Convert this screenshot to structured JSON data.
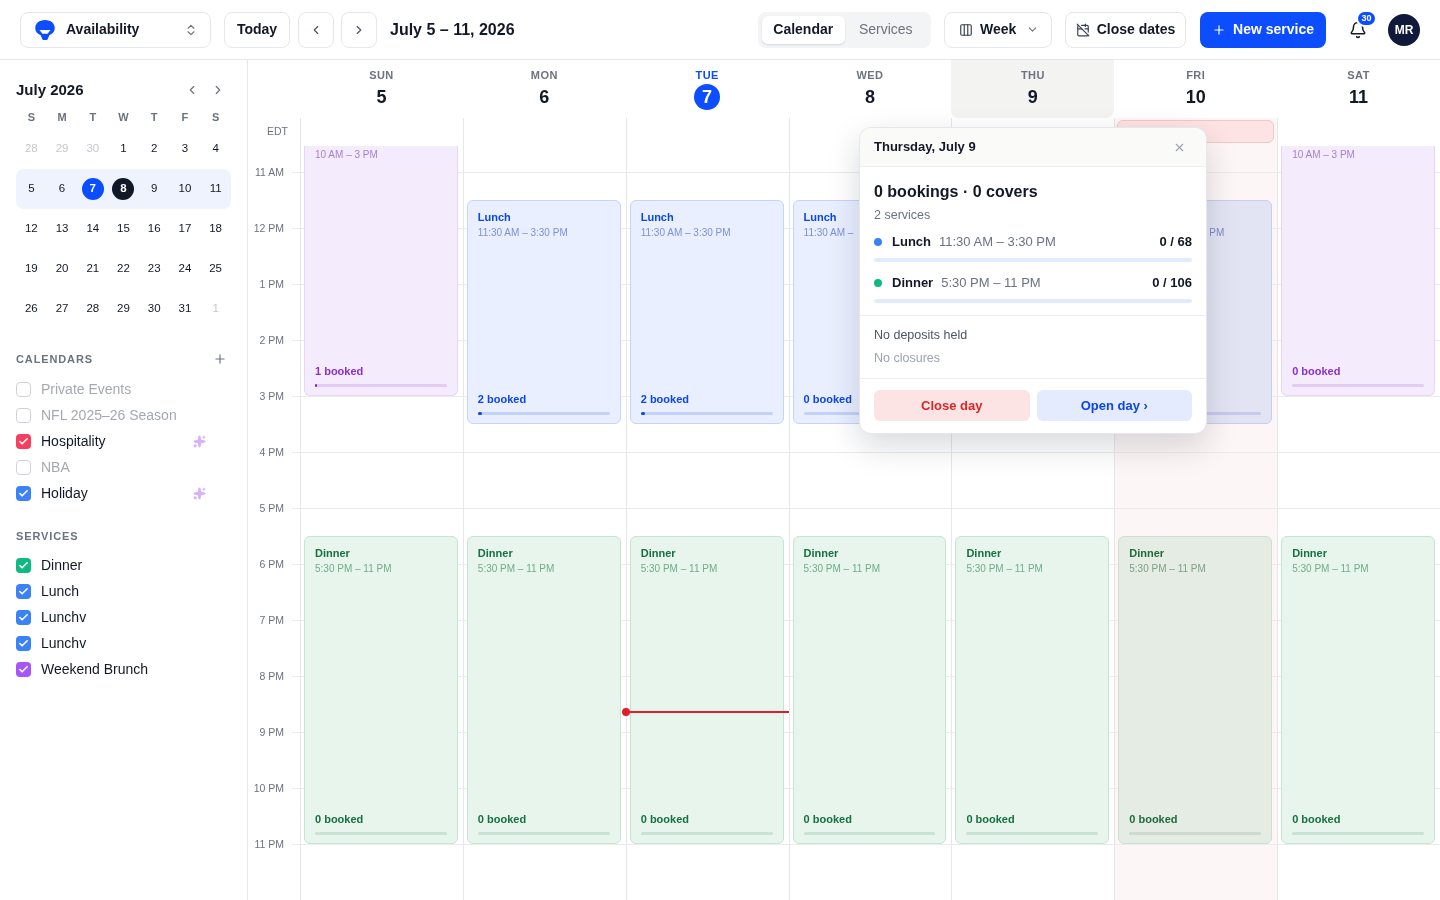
{
  "toolbar": {
    "workspace_select": {
      "label": "Availability"
    },
    "today_button": {
      "label": "Today"
    },
    "date_range": "July 5 – 11, 2026",
    "view_tabs": [
      {
        "label": "Calendar",
        "selected": true
      },
      {
        "label": "Services",
        "selected": false
      }
    ],
    "view_menu": {
      "label": "Week"
    },
    "close_dates_button": {
      "label": "Close dates"
    },
    "new_service_button": {
      "label": "New service"
    },
    "notifications": {
      "badge": "30"
    },
    "avatar": {
      "initials": "MR"
    }
  },
  "sidebar": {
    "mini_calendar": {
      "title": "July 2026",
      "weekdays": [
        "S",
        "M",
        "T",
        "W",
        "T",
        "F",
        "S"
      ],
      "weeks": [
        {
          "selected": false,
          "days": [
            {
              "label": "28",
              "outside": true,
              "today": false,
              "selected": false
            },
            {
              "label": "29",
              "outside": true,
              "today": false,
              "selected": false
            },
            {
              "label": "30",
              "outside": true,
              "today": false,
              "selected": false
            },
            {
              "label": "1",
              "outside": false,
              "today": false,
              "selected": false
            },
            {
              "label": "2",
              "outside": false,
              "today": false,
              "selected": false
            },
            {
              "label": "3",
              "outside": false,
              "today": false,
              "selected": false
            },
            {
              "label": "4",
              "outside": false,
              "today": false,
              "selected": false
            }
          ]
        },
        {
          "selected": true,
          "days": [
            {
              "label": "5",
              "outside": false,
              "today": false,
              "selected": false
            },
            {
              "label": "6",
              "outside": false,
              "today": false,
              "selected": false
            },
            {
              "label": "7",
              "outside": false,
              "today": true,
              "selected": false
            },
            {
              "label": "8",
              "outside": false,
              "today": false,
              "selected": true
            },
            {
              "label": "9",
              "outside": false,
              "today": false,
              "selected": false
            },
            {
              "label": "10",
              "outside": false,
              "today": false,
              "selected": false
            },
            {
              "label": "11",
              "outside": false,
              "today": false,
              "selected": false
            }
          ]
        },
        {
          "selected": false,
          "days": [
            {
              "label": "12",
              "outside": false,
              "today": false,
              "selected": false
            },
            {
              "label": "13",
              "outside": false,
              "today": false,
              "selected": false
            },
            {
              "label": "14",
              "outside": false,
              "today": false,
              "selected": false
            },
            {
              "label": "15",
              "outside": false,
              "today": false,
              "selected": false
            },
            {
              "label": "16",
              "outside": false,
              "today": false,
              "selected": false
            },
            {
              "label": "17",
              "outside": false,
              "today": false,
              "selected": false
            },
            {
              "label": "18",
              "outside": false,
              "today": false,
              "selected": false
            }
          ]
        },
        {
          "selected": false,
          "days": [
            {
              "label": "19",
              "outside": false,
              "today": false,
              "selected": false
            },
            {
              "label": "20",
              "outside": false,
              "today": false,
              "selected": false
            },
            {
              "label": "21",
              "outside": false,
              "today": false,
              "selected": false
            },
            {
              "label": "22",
              "outside": false,
              "today": false,
              "selected": false
            },
            {
              "label": "23",
              "outside": false,
              "today": false,
              "selected": false
            },
            {
              "label": "24",
              "outside": false,
              "today": false,
              "selected": false
            },
            {
              "label": "25",
              "outside": false,
              "today": false,
              "selected": false
            }
          ]
        },
        {
          "selected": false,
          "days": [
            {
              "label": "26",
              "outside": false,
              "today": false,
              "selected": false
            },
            {
              "label": "27",
              "outside": false,
              "today": false,
              "selected": false
            },
            {
              "label": "28",
              "outside": false,
              "today": false,
              "selected": false
            },
            {
              "label": "29",
              "outside": false,
              "today": false,
              "selected": false
            },
            {
              "label": "30",
              "outside": false,
              "today": false,
              "selected": false
            },
            {
              "label": "31",
              "outside": false,
              "today": false,
              "selected": false
            },
            {
              "label": "1",
              "outside": true,
              "today": false,
              "selected": false
            }
          ]
        }
      ]
    },
    "calendars": {
      "title": "CALENDARS",
      "items": [
        {
          "label": "Private Events",
          "checked": false,
          "sparkle": false
        },
        {
          "label": "NFL 2025–26 Season",
          "checked": false,
          "sparkle": false
        },
        {
          "label": "Hospitality",
          "checked": true,
          "color": "#f43f5e",
          "sparkle": true
        },
        {
          "label": "NBA",
          "checked": false,
          "sparkle": false
        },
        {
          "label": "Holiday",
          "checked": true,
          "color": "#3b82f6",
          "sparkle": true
        }
      ]
    },
    "services": {
      "title": "SERVICES",
      "items": [
        {
          "label": "Dinner",
          "checked": true,
          "color": "#10b981"
        },
        {
          "label": "Lunch",
          "checked": true,
          "color": "#3b82f6"
        },
        {
          "label": "Lunchv",
          "checked": true,
          "color": "#3b82f6"
        },
        {
          "label": "Lunchv",
          "checked": true,
          "color": "#3b82f6"
        },
        {
          "label": "Weekend Brunch",
          "checked": true,
          "color": "#a855f7"
        }
      ]
    }
  },
  "week": {
    "timezone": "EDT",
    "hours": [
      "11 AM",
      "12 PM",
      "1 PM",
      "2 PM",
      "3 PM",
      "4 PM",
      "5 PM",
      "6 PM",
      "7 PM",
      "8 PM",
      "9 PM",
      "10 PM",
      "11 PM"
    ],
    "days": [
      {
        "weekday": "SUN",
        "date": "5",
        "today": false,
        "selected": false,
        "closed": false,
        "now_line": false,
        "events": [
          {
            "kind": "brunch",
            "time": "10 AM – 3 PM",
            "booked": "1 booked",
            "level": 0.015
          },
          {
            "kind": "dinner",
            "title": "Dinner",
            "time": "5:30 PM – 11 PM",
            "booked": "0 booked",
            "level": 0
          }
        ]
      },
      {
        "weekday": "MON",
        "date": "6",
        "today": false,
        "selected": false,
        "closed": false,
        "now_line": false,
        "events": [
          {
            "kind": "lunch",
            "title": "Lunch",
            "time": "11:30 AM – 3:30 PM",
            "booked": "2 booked",
            "level": 0.03
          },
          {
            "kind": "dinner",
            "title": "Dinner",
            "time": "5:30 PM – 11 PM",
            "booked": "0 booked",
            "level": 0
          }
        ]
      },
      {
        "weekday": "TUE",
        "date": "7",
        "today": true,
        "selected": false,
        "closed": false,
        "now_line": true,
        "events": [
          {
            "kind": "lunch",
            "title": "Lunch",
            "time": "11:30 AM – 3:30 PM",
            "booked": "2 booked",
            "level": 0.03
          },
          {
            "kind": "dinner",
            "title": "Dinner",
            "time": "5:30 PM – 11 PM",
            "booked": "0 booked",
            "level": 0
          }
        ]
      },
      {
        "weekday": "WED",
        "date": "8",
        "today": false,
        "selected": false,
        "closed": false,
        "now_line": false,
        "events": [
          {
            "kind": "lunch",
            "title": "Lunch",
            "time": "11:30 AM –",
            "booked": "0 booked",
            "level": 0
          },
          {
            "kind": "dinner",
            "title": "Dinner",
            "time": "5:30 PM – 11 PM",
            "booked": "0 booked",
            "level": 0
          }
        ]
      },
      {
        "weekday": "THU",
        "date": "9",
        "today": false,
        "selected": true,
        "closed": false,
        "now_line": false,
        "events": [
          {
            "kind": "dinner",
            "title": "Dinner",
            "time": "5:30 PM – 11 PM",
            "booked": "0 booked",
            "level": 0
          }
        ]
      },
      {
        "weekday": "FRI",
        "date": "10",
        "today": false,
        "selected": false,
        "closed": true,
        "now_line": false,
        "events": [
          {
            "kind": "lunch",
            "time": "PM"
          },
          {
            "kind": "dinner",
            "title": "Dinner",
            "time": "5:30 PM – 11 PM",
            "booked": "0 booked",
            "level": 0
          }
        ]
      },
      {
        "weekday": "SAT",
        "date": "11",
        "today": false,
        "selected": false,
        "closed": false,
        "now_line": false,
        "events": [
          {
            "kind": "brunch",
            "time": "10 AM – 3 PM",
            "booked": "0 booked",
            "level": 0
          },
          {
            "kind": "dinner",
            "title": "Dinner",
            "time": "5:30 PM – 11 PM",
            "booked": "0 booked",
            "level": 0
          }
        ]
      }
    ]
  },
  "day_popover": {
    "title": "Thursday, July 9",
    "summary": "0 bookings · 0 covers",
    "subtitle": "2 services",
    "services": [
      {
        "name": "Lunch",
        "time": "11:30 AM – 3:30 PM",
        "count": "0 / 68",
        "color": "#3b82f6",
        "level": 0
      },
      {
        "name": "Dinner",
        "time": "5:30 PM – 11 PM",
        "count": "0 / 106",
        "color": "#10b981",
        "level": 0
      }
    ],
    "notes": [
      {
        "text": "No deposits held",
        "kind": "primary"
      },
      {
        "text": "No closures",
        "kind": "muted"
      }
    ],
    "actions": [
      {
        "label": "Close day",
        "kind": "danger"
      },
      {
        "label": "Open day ›",
        "kind": "primary"
      }
    ]
  }
}
